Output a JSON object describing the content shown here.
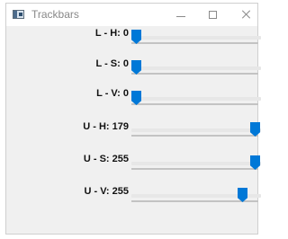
{
  "window": {
    "title": "Trackbars"
  },
  "trackbars": [
    {
      "label": "L - H: 0",
      "value": 0,
      "max": 179
    },
    {
      "label": "L - S: 0",
      "value": 0,
      "max": 255
    },
    {
      "label": "L - V: 0",
      "value": 0,
      "max": 255
    },
    {
      "label": "U - H: 179",
      "value": 179,
      "max": 179
    },
    {
      "label": "U - S: 255",
      "value": 255,
      "max": 255
    },
    {
      "label": "U - V: 255",
      "value": 255,
      "max": 255
    }
  ],
  "colors": {
    "thumb": "#0078d7",
    "track": "#e7e7e7",
    "track_line": "#c3c3c3",
    "window_background": "#f0f0f0"
  }
}
